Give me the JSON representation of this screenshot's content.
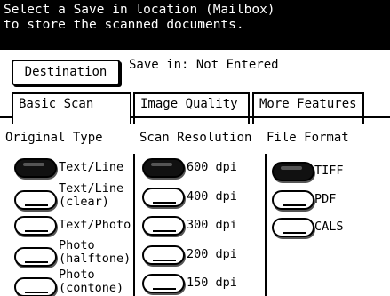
{
  "message": "Select a Save in location (Mailbox)\nto store the scanned documents.",
  "destination": {
    "button_label": "Destination",
    "save_in_text": "Save in: Not Entered"
  },
  "tabs": [
    {
      "label": "Basic Scan",
      "active": true
    },
    {
      "label": "Image Quality",
      "active": false
    },
    {
      "label": "More Features",
      "active": false
    }
  ],
  "original_type": {
    "header": "Original Type",
    "options": [
      {
        "label": "Text/Line",
        "selected": true
      },
      {
        "label": "Text/Line\n(clear)",
        "selected": false
      },
      {
        "label": "Text/Photo",
        "selected": false
      },
      {
        "label": "Photo\n(halftone)",
        "selected": false
      },
      {
        "label": "Photo\n(contone)",
        "selected": false
      }
    ]
  },
  "scan_resolution": {
    "header": "Scan Resolution",
    "options": [
      {
        "label": "600 dpi",
        "selected": true
      },
      {
        "label": "400 dpi",
        "selected": false
      },
      {
        "label": "300 dpi",
        "selected": false
      },
      {
        "label": "200 dpi",
        "selected": false
      },
      {
        "label": "150 dpi",
        "selected": false
      }
    ]
  },
  "file_format": {
    "header": "File Format",
    "options": [
      {
        "label": "TIFF",
        "selected": true
      },
      {
        "label": "PDF",
        "selected": false
      },
      {
        "label": "CALS",
        "selected": false
      }
    ]
  }
}
